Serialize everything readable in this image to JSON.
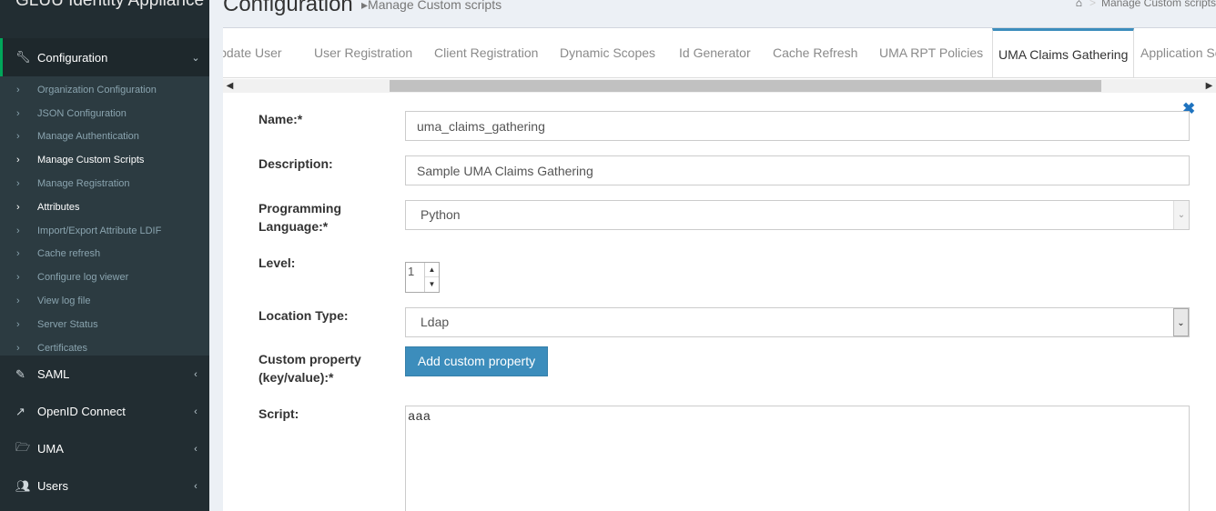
{
  "app": {
    "brand": "GLUU Identity Appliance"
  },
  "sidebar": {
    "config": {
      "label": "Configuration",
      "icon": "wrench-icon"
    },
    "sub_items": [
      {
        "label": "Organization Configuration"
      },
      {
        "label": "JSON Configuration"
      },
      {
        "label": "Manage Authentication"
      },
      {
        "label": "Manage Custom Scripts"
      },
      {
        "label": "Manage Registration"
      },
      {
        "label": "Attributes"
      },
      {
        "label": "Import/Export Attribute LDIF"
      },
      {
        "label": "Cache refresh"
      },
      {
        "label": "Configure log viewer"
      },
      {
        "label": "View log file"
      },
      {
        "label": "Server Status"
      },
      {
        "label": "Certificates"
      }
    ],
    "menus": [
      {
        "label": "SAML",
        "icon": "edit-icon"
      },
      {
        "label": "OpenID Connect",
        "icon": "external-link-icon"
      },
      {
        "label": "UMA",
        "icon": "folder-open-icon"
      },
      {
        "label": "Users",
        "icon": "users-icon"
      }
    ]
  },
  "header": {
    "title": "Configuration",
    "subtitle": "Manage Custom scripts",
    "breadcrumb": "Manage Custom scripts"
  },
  "tabs": [
    {
      "label": "Update User"
    },
    {
      "label": "User Registration"
    },
    {
      "label": "Client Registration"
    },
    {
      "label": "Dynamic Scopes"
    },
    {
      "label": "Id Generator"
    },
    {
      "label": "Cache Refresh"
    },
    {
      "label": "UMA RPT Policies"
    },
    {
      "label": "UMA Claims Gathering",
      "active": true
    },
    {
      "label": "Application Session"
    }
  ],
  "form": {
    "name_label": "Name:*",
    "name_value": "uma_claims_gathering",
    "description_label": "Description:",
    "description_value": "Sample UMA Claims Gathering",
    "language_label_1": "Programming",
    "language_label_2": "Language:*",
    "language_value": "Python",
    "level_label": "Level:",
    "level_value": "1",
    "location_label": "Location Type:",
    "location_value": "Ldap",
    "custom_label_1": "Custom property",
    "custom_label_2": "(key/value):*",
    "add_custom_button": "Add custom property",
    "script_label": "Script:",
    "script_value": "aaa"
  }
}
